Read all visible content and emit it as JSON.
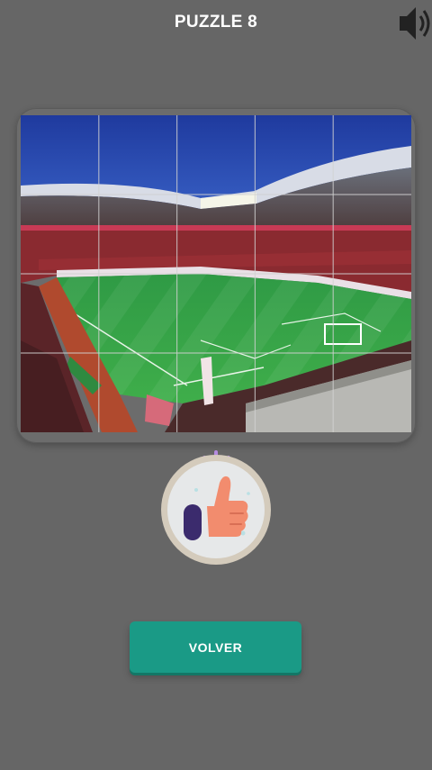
{
  "header": {
    "title": "PUZZLE 8"
  },
  "icons": {
    "sound": "speaker-volume-icon",
    "success": "thumbs-up-icon"
  },
  "puzzle": {
    "grid_columns": 5,
    "grid_rows": 4
  },
  "actions": {
    "back_label": "VOLVER"
  },
  "colors": {
    "background": "#666666",
    "button": "#1a9a86",
    "thumb": "#f28c6e",
    "cuff": "#3b2b6d"
  }
}
